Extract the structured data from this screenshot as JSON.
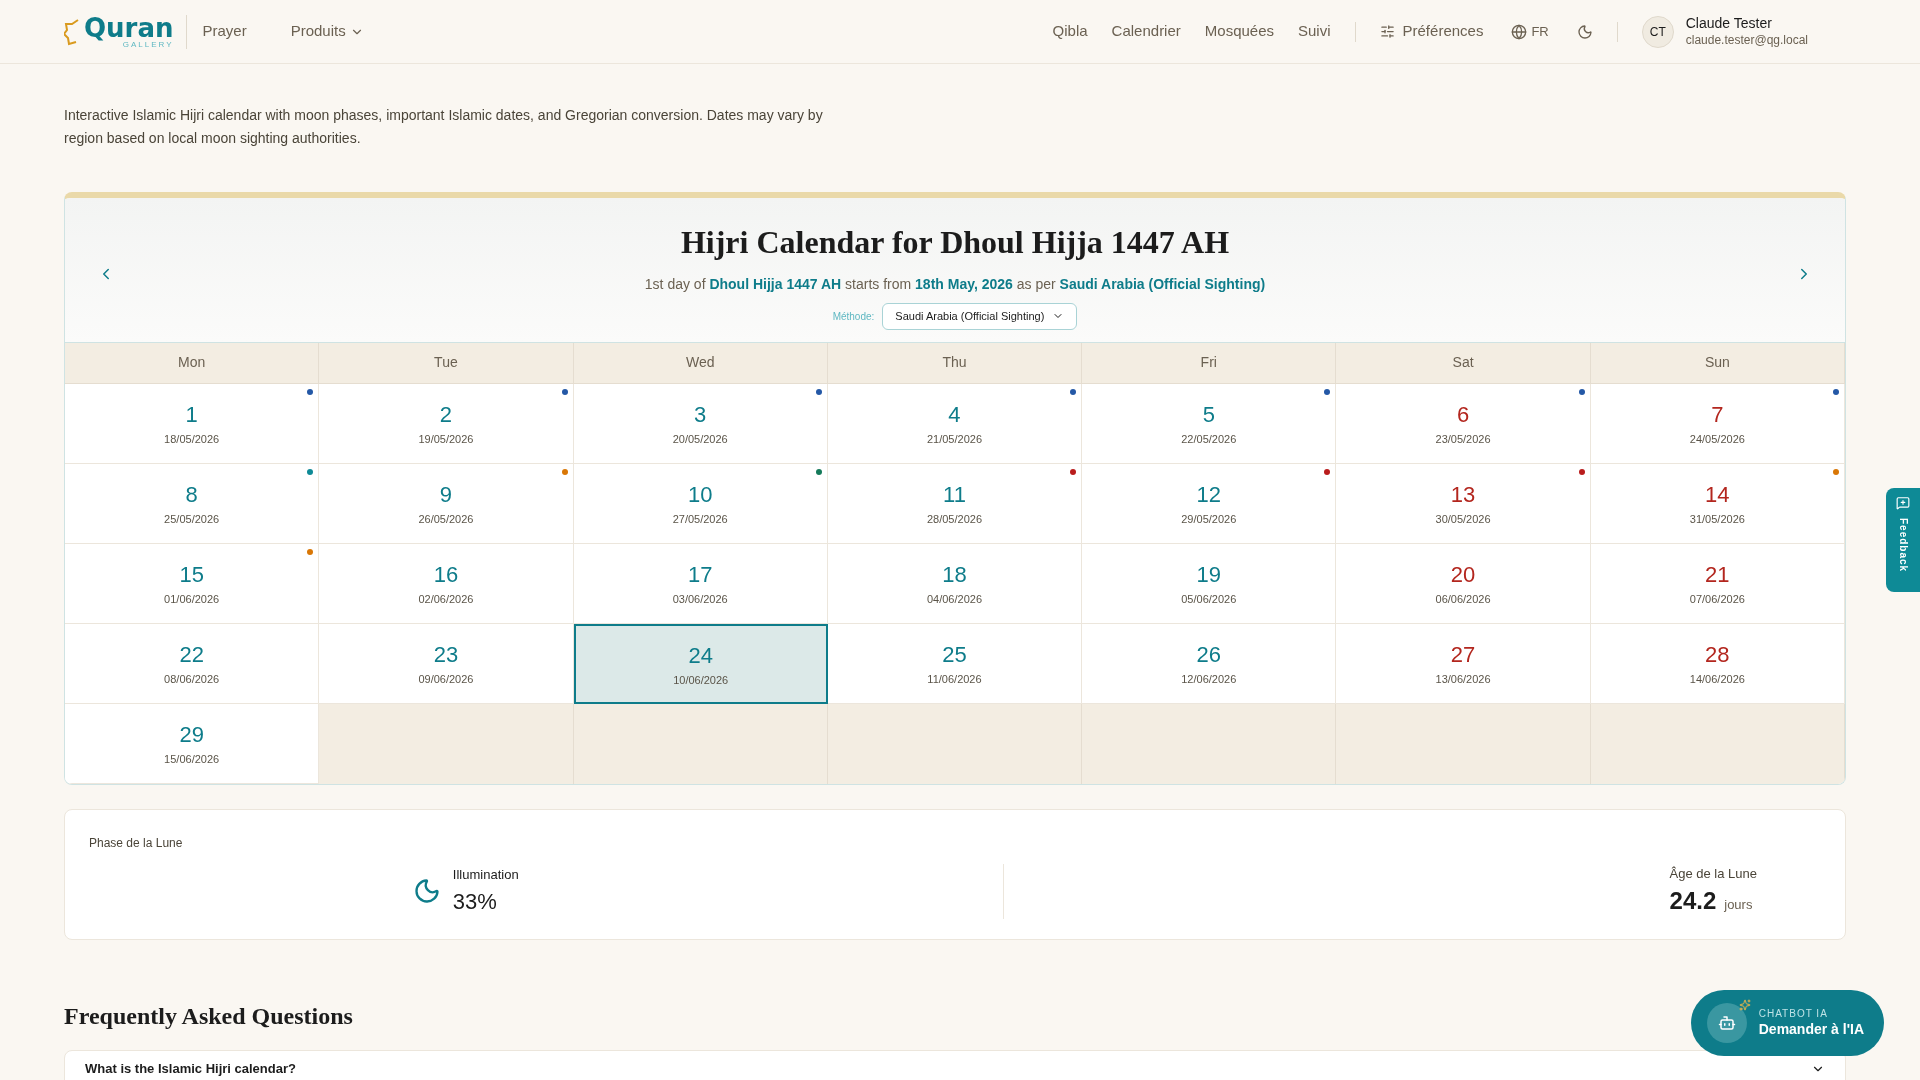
{
  "logo": {
    "name": "Quran",
    "tagline": "GALLERY"
  },
  "nav_left": [
    {
      "label": "Prayer",
      "dropdown": false
    },
    {
      "label": "Produits",
      "dropdown": true
    }
  ],
  "nav_right": [
    "Qibla",
    "Calendrier",
    "Mosquées",
    "Suivi"
  ],
  "preferences": "Préférences",
  "language": "FR",
  "user": {
    "initials": "CT",
    "name": "Claude Tester",
    "email": "claude.tester@qg.local"
  },
  "description": "Interactive Islamic Hijri calendar with moon phases, important Islamic dates, and Gregorian conversion. Dates may vary by region based on local moon sighting authorities.",
  "calendar": {
    "title": "Hijri Calendar for Dhoul Hijja 1447 AH",
    "subtitle": "1st day of **Dhoul Hijja 1447 AH** starts from **18th May, 2026** as per **Saudi Arabia (Official Sighting)**",
    "method_label": "Méthode:",
    "method_value": "Saudi Arabia (Official Sighting)",
    "weekdays": [
      "Mon",
      "Tue",
      "Wed",
      "Thu",
      "Fri",
      "Sat",
      "Sun"
    ],
    "days": [
      {
        "hijri": "1",
        "date": "18/05/2026",
        "weekend": false,
        "selected": false,
        "color": "#2458a6"
      },
      {
        "hijri": "2",
        "date": "19/05/2026",
        "weekend": false,
        "selected": false,
        "color": "#2458a6"
      },
      {
        "hijri": "3",
        "date": "20/05/2026",
        "weekend": false,
        "selected": false,
        "color": "#2458a6"
      },
      {
        "hijri": "4",
        "date": "21/05/2026",
        "weekend": false,
        "selected": false,
        "color": "#2458a6"
      },
      {
        "hijri": "5",
        "date": "22/05/2026",
        "weekend": false,
        "selected": false,
        "color": "#2458a6"
      },
      {
        "hijri": "6",
        "date": "23/05/2026",
        "weekend": true,
        "selected": false,
        "color": "#2458a6"
      },
      {
        "hijri": "7",
        "date": "24/05/2026",
        "weekend": true,
        "selected": false,
        "color": "#2458a6"
      },
      {
        "hijri": "8",
        "date": "25/05/2026",
        "weekend": false,
        "selected": false,
        "color": "#0e8a96"
      },
      {
        "hijri": "9",
        "date": "26/05/2026",
        "weekend": false,
        "selected": false,
        "color": "#d97706"
      },
      {
        "hijri": "10",
        "date": "27/05/2026",
        "weekend": false,
        "selected": false,
        "color": "#157a5a"
      },
      {
        "hijri": "11",
        "date": "28/05/2026",
        "weekend": false,
        "selected": false,
        "color": "#b91c1c"
      },
      {
        "hijri": "12",
        "date": "29/05/2026",
        "weekend": false,
        "selected": false,
        "color": "#b91c1c"
      },
      {
        "hijri": "13",
        "date": "30/05/2026",
        "weekend": true,
        "selected": false,
        "color": "#b91c1c"
      },
      {
        "hijri": "14",
        "date": "31/05/2026",
        "weekend": true,
        "selected": false,
        "color": "#d97706"
      },
      {
        "hijri": "15",
        "date": "01/06/2026",
        "weekend": false,
        "selected": false,
        "color": "#d97706"
      },
      {
        "hijri": "16",
        "date": "02/06/2026",
        "weekend": false,
        "selected": false
      },
      {
        "hijri": "17",
        "date": "03/06/2026",
        "weekend": false,
        "selected": false
      },
      {
        "hijri": "18",
        "date": "04/06/2026",
        "weekend": false,
        "selected": false
      },
      {
        "hijri": "19",
        "date": "05/06/2026",
        "weekend": false,
        "selected": false
      },
      {
        "hijri": "20",
        "date": "06/06/2026",
        "weekend": true,
        "selected": false
      },
      {
        "hijri": "21",
        "date": "07/06/2026",
        "weekend": true,
        "selected": false
      },
      {
        "hijri": "22",
        "date": "08/06/2026",
        "weekend": false,
        "selected": false
      },
      {
        "hijri": "23",
        "date": "09/06/2026",
        "weekend": false,
        "selected": false
      },
      {
        "hijri": "24",
        "date": "10/06/2026",
        "weekend": false,
        "selected": true
      },
      {
        "hijri": "25",
        "date": "11/06/2026",
        "weekend": false,
        "selected": false
      },
      {
        "hijri": "26",
        "date": "12/06/2026",
        "weekend": false,
        "selected": false
      },
      {
        "hijri": "27",
        "date": "13/06/2026",
        "weekend": true,
        "selected": false
      },
      {
        "hijri": "28",
        "date": "14/06/2026",
        "weekend": true,
        "selected": false
      },
      {
        "hijri": "29",
        "date": "15/06/2026",
        "weekend": false,
        "selected": false
      }
    ]
  },
  "moon": {
    "title": "Phase de la Lune",
    "illumination_label": "Illumination",
    "illumination": "33%",
    "age_label": "Âge de la Lune",
    "age": "24.2",
    "age_unit": "jours"
  },
  "faq": {
    "title": "Frequently Asked Questions",
    "questions": [
      "What is the Islamic Hijri calendar?"
    ]
  },
  "feedback": "Feedback",
  "chatbot": {
    "kicker": "CHATBOT IA",
    "label": "Demander à l'IA"
  }
}
